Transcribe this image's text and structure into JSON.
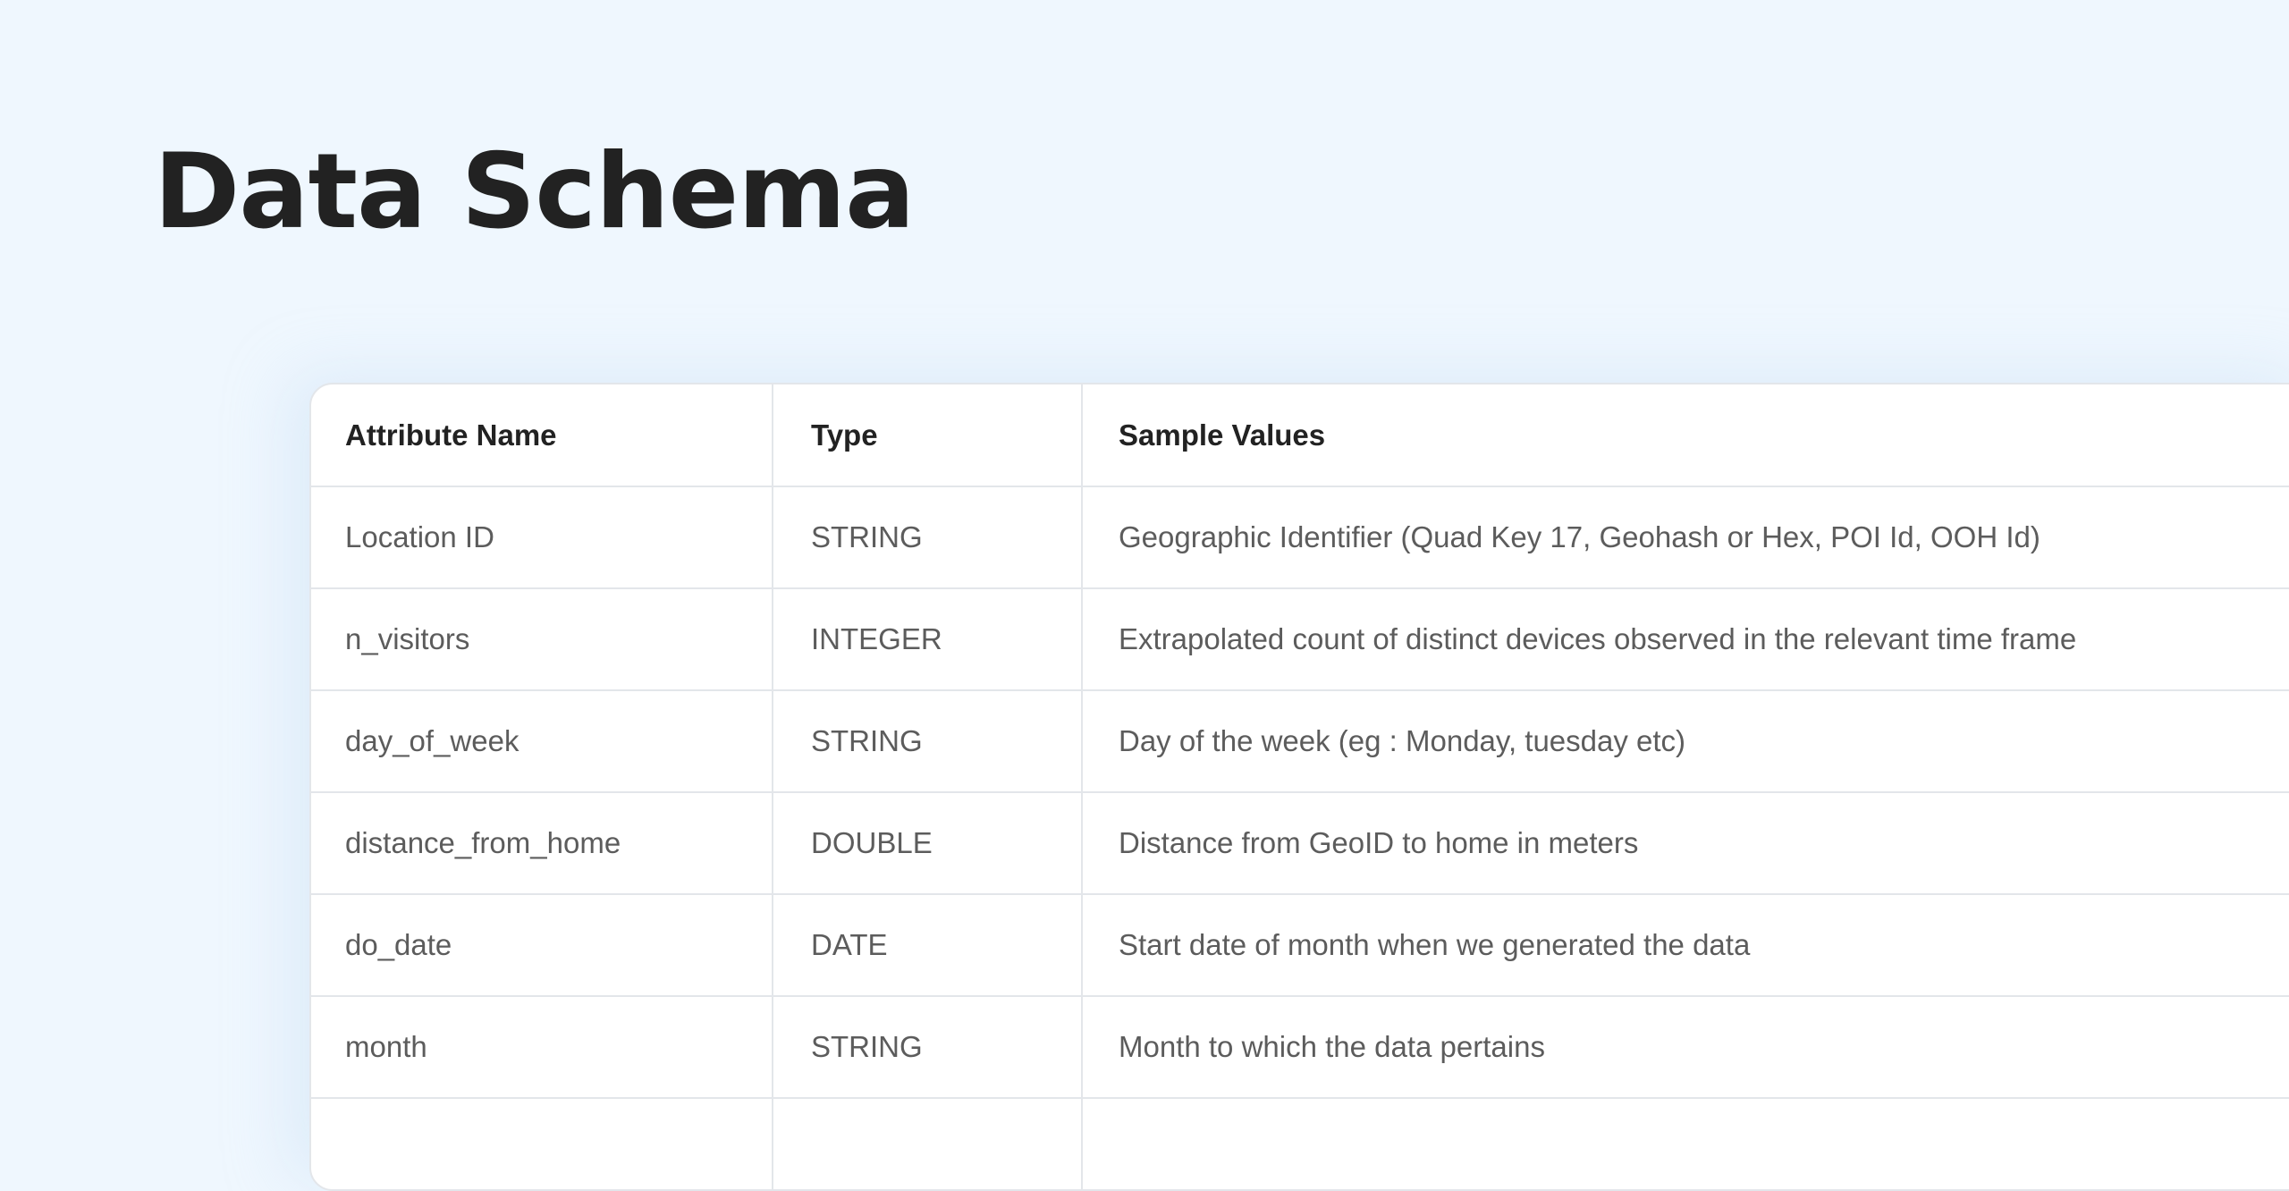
{
  "page": {
    "title": "Data Schema"
  },
  "table": {
    "headers": [
      "Attribute Name",
      "Type",
      "Sample Values"
    ],
    "rows": [
      [
        "Location ID",
        "STRING",
        "Geographic Identifier (Quad Key 17, Geohash or Hex, POI Id, OOH Id)"
      ],
      [
        "n_visitors",
        "INTEGER",
        "Extrapolated count of distinct devices observed in the relevant time frame"
      ],
      [
        "day_of_week",
        "STRING",
        "Day of the week (eg : Monday, tuesday etc)"
      ],
      [
        "distance_from_home",
        "DOUBLE",
        "Distance from GeoID to home in meters"
      ],
      [
        "do_date",
        "DATE",
        "Start date of month when we generated the data"
      ],
      [
        "month",
        "STRING",
        "Month to which the data pertains"
      ],
      [
        "",
        "",
        ""
      ]
    ]
  },
  "colors": {
    "background": "#eff7fe",
    "card": "#ffffff",
    "border": "#e3e6ea",
    "heading_text": "#222222",
    "cell_text": "#5c5c5c"
  }
}
